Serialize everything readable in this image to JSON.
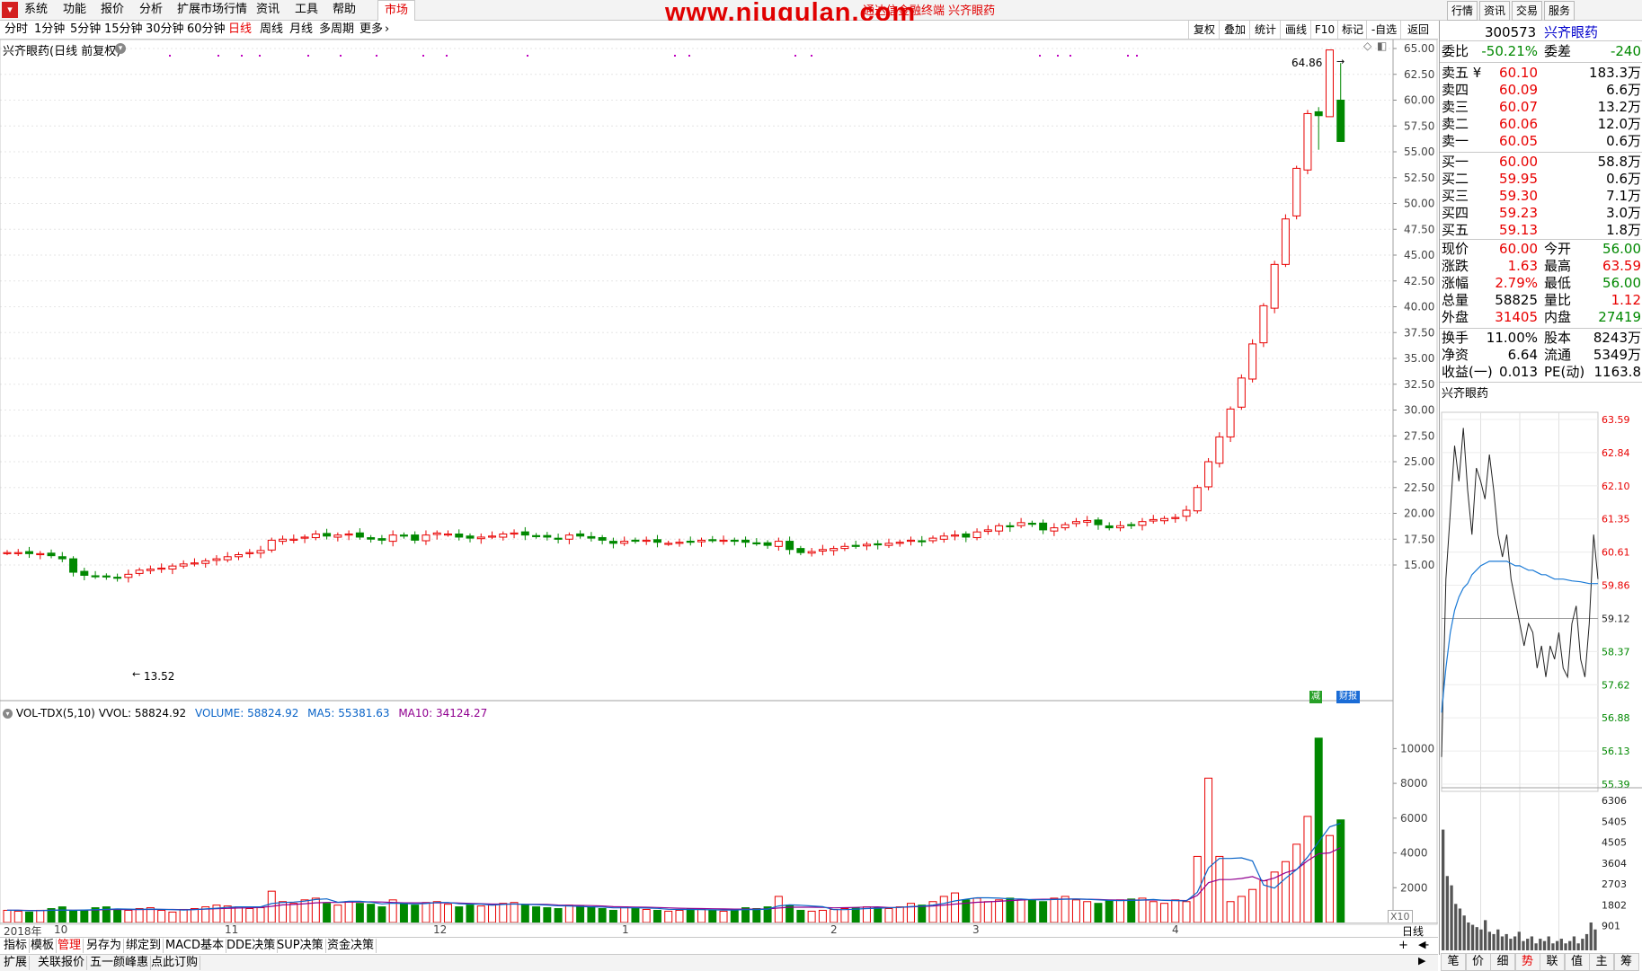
{
  "menu": {
    "items": [
      "系统",
      "功能",
      "报价",
      "分析",
      "扩展市场行情",
      "资讯",
      "工具",
      "帮助"
    ],
    "market_tab": "市场",
    "watermark": "www.niugulan.com",
    "watermark_sub": "通达信金融终端 兴齐眼药",
    "right_buttons": [
      "行情",
      "资讯",
      "交易",
      "服务"
    ]
  },
  "periods": [
    "分时",
    "1分钟",
    "5分钟",
    "15分钟",
    "30分钟",
    "60分钟",
    "日线",
    "周线",
    "月线",
    "多周期",
    "更多"
  ],
  "active_period": "日线",
  "tools": [
    "复权",
    "叠加",
    "统计",
    "画线",
    "F10",
    "标记",
    "-自选",
    "返回"
  ],
  "main_chart": {
    "title": "兴齐眼药(日线 前复权)",
    "low_label": "13.52",
    "high_label": "64.86",
    "price_ticks": [
      "65.00",
      "62.50",
      "60.00",
      "57.50",
      "55.00",
      "52.50",
      "50.00",
      "47.50",
      "45.00",
      "42.50",
      "40.00",
      "37.50",
      "35.00",
      "32.50",
      "30.00",
      "27.50",
      "25.00",
      "22.50",
      "20.00",
      "17.50",
      "15.00"
    ],
    "badge1": "减",
    "badge2": "财报"
  },
  "vol_chart": {
    "title": "VOL-TDX(5,10)",
    "vvol": "VVOL: 58824.92",
    "volume": "VOLUME: 58824.92",
    "ma5": "MA5: 55381.63",
    "ma10": "MA10: 34124.27",
    "ticks": [
      "10000",
      "8000",
      "6000",
      "4000",
      "2000"
    ],
    "scale": "X10"
  },
  "date_axis": {
    "labels": [
      "2018年",
      "10",
      "11",
      "12",
      "1",
      "2",
      "3",
      "4"
    ],
    "right": "日线"
  },
  "chart_data": [
    {
      "type": "candlestick",
      "title": "兴齐眼药(日线 前复权)",
      "ylim": [
        15.0,
        65.0
      ],
      "low_mark": 13.52,
      "high_mark": 64.86,
      "x_labels": [
        "2018年",
        "10",
        "11",
        "12",
        "1",
        "2",
        "3",
        "4"
      ],
      "series": [
        {
          "name": "close (approx.)",
          "values": [
            16.2,
            16.2,
            16.1,
            16.1,
            15.9,
            15.6,
            14.3,
            14.0,
            13.9,
            13.9,
            13.8,
            14.1,
            14.5,
            14.6,
            14.7,
            14.9,
            15.1,
            15.2,
            15.4,
            15.6,
            15.8,
            16.0,
            16.2,
            16.4,
            17.4,
            17.5,
            17.5,
            17.7,
            18.0,
            17.8,
            17.9,
            18.0,
            17.7,
            17.5,
            17.4,
            17.9,
            17.8,
            17.4,
            17.9,
            18.1,
            18.0,
            17.7,
            17.6,
            17.7,
            17.8,
            18.0,
            18.1,
            17.9,
            17.8,
            17.7,
            17.5,
            17.9,
            17.8,
            17.6,
            17.4,
            17.1,
            17.3,
            17.4,
            17.4,
            17.2,
            17.1,
            17.2,
            17.3,
            17.4,
            17.4,
            17.4,
            17.3,
            17.2,
            17.1,
            16.9,
            17.3,
            16.5,
            16.2,
            16.3,
            16.5,
            16.6,
            16.8,
            16.9,
            17.0,
            17.0,
            17.1,
            17.2,
            17.4,
            17.3,
            17.6,
            17.8,
            17.9,
            17.7,
            18.2,
            18.4,
            18.8,
            18.7,
            19.1,
            19.0,
            18.4,
            18.6,
            18.9,
            19.2,
            19.3,
            18.9,
            18.6,
            18.8,
            18.9,
            19.2,
            19.4,
            19.5,
            19.6,
            20.3,
            22.5,
            25.0,
            27.4,
            30.1,
            33.1,
            36.4,
            40.1,
            44.1,
            48.5,
            53.4,
            58.7,
            58.5,
            64.8,
            60.0
          ]
        }
      ]
    },
    {
      "type": "bar",
      "title": "VOL-TDX(5,10)",
      "ylim": [
        0,
        11000
      ],
      "series": [
        {
          "name": "VOLUME",
          "values": [
            700,
            650,
            600,
            700,
            800,
            900,
            650,
            700,
            850,
            900,
            750,
            700,
            800,
            850,
            700,
            600,
            750,
            800,
            900,
            1000,
            950,
            900,
            800,
            850,
            1800,
            1200,
            1100,
            1300,
            1400,
            1100,
            1000,
            1200,
            1100,
            1050,
            900,
            1300,
            1100,
            1000,
            1150,
            1200,
            1050,
            900,
            1000,
            950,
            1000,
            1100,
            1150,
            1000,
            900,
            850,
            800,
            1000,
            950,
            900,
            800,
            700,
            900,
            800,
            750,
            700,
            650,
            700,
            800,
            750,
            700,
            650,
            700,
            850,
            800,
            900,
            1500,
            1000,
            700,
            650,
            700,
            750,
            800,
            850,
            900,
            850,
            800,
            900,
            1100,
            1000,
            1200,
            1500,
            1700,
            1300,
            1400,
            1200,
            1300,
            1400,
            1300,
            1300,
            1200,
            1400,
            1500,
            1300,
            1200,
            1100,
            1250,
            1300,
            1350,
            1400,
            1200,
            1100,
            1300,
            1200,
            3800,
            8300,
            3800,
            1200,
            1500,
            1900,
            2400,
            2900,
            3500,
            4500,
            6100,
            10600,
            5000,
            5900
          ]
        },
        {
          "name": "MA5",
          "values": [
            700,
            700,
            680,
            680,
            700,
            720,
            700,
            720,
            740,
            760,
            780,
            770,
            760,
            770,
            760,
            740,
            720,
            740,
            780,
            820,
            870,
            900,
            900,
            900,
            1090,
            1150,
            1170,
            1230,
            1320,
            1360,
            1160,
            1220,
            1220,
            1170,
            1070,
            1110,
            1090,
            1070,
            1090,
            1150,
            1150,
            1080,
            1060,
            1060,
            1000,
            1040,
            1070,
            1040,
            1030,
            1000,
            960,
            950,
            920,
            900,
            890,
            840,
            840,
            840,
            830,
            810,
            760,
            750,
            750,
            740,
            730,
            720,
            720,
            740,
            740,
            770,
            950,
            1010,
            990,
            950,
            910,
            740,
            740,
            770,
            800,
            820,
            840,
            870,
            920,
            940,
            1000,
            1100,
            1240,
            1340,
            1420,
            1420,
            1400,
            1360,
            1350,
            1310,
            1300,
            1320,
            1340,
            1350,
            1340,
            1300,
            1270,
            1260,
            1270,
            1290,
            1320,
            1270,
            1260,
            1240,
            1740,
            3140,
            3680,
            3680,
            3720,
            3540,
            2160,
            1980,
            2540,
            3040,
            3760,
            4640,
            5500,
            5700
          ]
        },
        {
          "name": "MA10",
          "values": [
            700,
            700,
            690,
            690,
            700,
            710,
            700,
            710,
            720,
            740,
            750,
            745,
            740,
            755,
            750,
            750,
            740,
            750,
            770,
            790,
            810,
            830,
            840,
            860,
            930,
            1010,
            1040,
            1080,
            1130,
            1150,
            1150,
            1170,
            1180,
            1190,
            1180,
            1150,
            1130,
            1130,
            1130,
            1130,
            1130,
            1120,
            1100,
            1080,
            1060,
            1060,
            1060,
            1050,
            1050,
            1040,
            1000,
            990,
            980,
            970,
            950,
            910,
            900,
            890,
            880,
            860,
            840,
            820,
            810,
            800,
            790,
            780,
            770,
            770,
            770,
            780,
            830,
            880,
            880,
            880,
            870,
            840,
            850,
            870,
            890,
            900,
            860,
            870,
            900,
            920,
            950,
            1000,
            1060,
            1110,
            1160,
            1190,
            1220,
            1260,
            1290,
            1320,
            1340,
            1340,
            1350,
            1350,
            1340,
            1320,
            1300,
            1290,
            1290,
            1290,
            1290,
            1280,
            1270,
            1260,
            1560,
            2290,
            2470,
            2470,
            2530,
            2640,
            2390,
            2560,
            2860,
            3050,
            3550,
            3950,
            4000,
            4300
          ]
        }
      ]
    },
    {
      "type": "line",
      "title": "兴齐眼药",
      "ylim": [
        55.39,
        63.59
      ],
      "series": [
        {
          "name": "price",
          "values": [
            56.0,
            60.0,
            61.5,
            63.0,
            62.2,
            63.4,
            62.0,
            61.0,
            62.5,
            62.2,
            61.8,
            62.8,
            62.0,
            61.0,
            60.5,
            61.0,
            60.0,
            59.5,
            59.0,
            58.5,
            59.0,
            58.8,
            58.0,
            58.5,
            57.8,
            58.5,
            58.2,
            58.8,
            58.0,
            57.8,
            59.0,
            59.4,
            58.2,
            57.8,
            59.0,
            61.0,
            60.0
          ]
        },
        {
          "name": "avg",
          "values": [
            57.0,
            58.0,
            58.8,
            59.3,
            59.6,
            59.8,
            59.9,
            60.1,
            60.2,
            60.3,
            60.35,
            60.4,
            60.4,
            60.4,
            60.4,
            60.4,
            60.35,
            60.3,
            60.3,
            60.25,
            60.2,
            60.2,
            60.15,
            60.1,
            60.1,
            60.05,
            60.0,
            60.0,
            60.0,
            59.98,
            59.96,
            59.95,
            59.94,
            59.92,
            59.9,
            59.9,
            59.9
          ]
        }
      ]
    },
    {
      "type": "bar",
      "title": "",
      "ylim": [
        0,
        6306
      ],
      "series": [
        {
          "name": "intraday volume",
          "values": [
            5200,
            3200,
            2800,
            2000,
            1800,
            1500,
            1200,
            1100,
            1000,
            900,
            1300,
            800,
            700,
            900,
            600,
            700,
            500,
            600,
            800,
            400,
            500,
            600,
            300,
            500,
            400,
            600,
            300,
            400,
            500,
            300,
            400,
            600,
            300,
            500,
            700,
            1200,
            900
          ]
        }
      ]
    }
  ],
  "info": {
    "code": "300573",
    "name": "兴齐眼药",
    "weibi_label": "委比",
    "weibi": "-50.21%",
    "weicha_label": "委差",
    "weicha": "-240",
    "asks": [
      {
        "label": "卖五",
        "marker": "¥",
        "price": "60.10",
        "vol": "183.3万"
      },
      {
        "label": "卖四",
        "marker": "",
        "price": "60.09",
        "vol": "6.6万"
      },
      {
        "label": "卖三",
        "marker": "",
        "price": "60.07",
        "vol": "13.2万"
      },
      {
        "label": "卖二",
        "marker": "",
        "price": "60.06",
        "vol": "12.0万"
      },
      {
        "label": "卖一",
        "marker": "",
        "price": "60.05",
        "vol": "0.6万"
      }
    ],
    "bids": [
      {
        "label": "买一",
        "price": "60.00",
        "vol": "58.8万"
      },
      {
        "label": "买二",
        "price": "59.95",
        "vol": "0.6万"
      },
      {
        "label": "买三",
        "price": "59.30",
        "vol": "7.1万"
      },
      {
        "label": "买四",
        "price": "59.23",
        "vol": "3.0万"
      },
      {
        "label": "买五",
        "price": "59.13",
        "vol": "1.8万"
      }
    ],
    "stats1": [
      {
        "k": "现价",
        "v": "60.00",
        "vc": "red",
        "k2": "今开",
        "v2": "56.00",
        "v2c": "green"
      },
      {
        "k": "涨跌",
        "v": "1.63",
        "vc": "red",
        "k2": "最高",
        "v2": "63.59",
        "v2c": "red"
      },
      {
        "k": "涨幅",
        "v": "2.79%",
        "vc": "red",
        "k2": "最低",
        "v2": "56.00",
        "v2c": "green"
      },
      {
        "k": "总量",
        "v": "58825",
        "vc": "black",
        "k2": "量比",
        "v2": "1.12",
        "v2c": "red"
      },
      {
        "k": "外盘",
        "v": "31405",
        "vc": "red",
        "k2": "内盘",
        "v2": "27419",
        "v2c": "green"
      }
    ],
    "stats2": [
      {
        "k": "换手",
        "v": "11.00%",
        "k2": "股本",
        "v2": "8243万"
      },
      {
        "k": "净资",
        "v": "6.64",
        "k2": "流通",
        "v2": "5349万"
      },
      {
        "k": "收益(一)",
        "v": "0.013",
        "k2": "PE(动)",
        "v2": "1163.8"
      }
    ],
    "mini_title": "兴齐眼药",
    "mini_ticks": [
      "63.59",
      "62.84",
      "62.10",
      "61.35",
      "60.61",
      "59.86",
      "59.12",
      "58.37",
      "57.62",
      "56.88",
      "56.13",
      "55.39"
    ],
    "mini_vol_ticks": [
      "6306",
      "5405",
      "4505",
      "3604",
      "2703",
      "1802",
      "901"
    ],
    "bottom_tabs": [
      "笔",
      "价",
      "细",
      "势",
      "联",
      "值",
      "主",
      "筹"
    ],
    "active_bottom_tab": "势"
  },
  "bottom": {
    "tabs1": [
      "指标",
      "模板",
      "管理",
      "另存为",
      "绑定到",
      "MACD基本",
      "DDE决策",
      "SUP决策",
      "资金决策"
    ],
    "active_tab1": "管理",
    "tabs2": [
      "扩展",
      "关联报价",
      "五一颜峰惠",
      "点此订购"
    ],
    "plus": "+",
    "minus": "−",
    "left_arrow": "◀",
    "right_arrow": "▶"
  },
  "colors": {
    "up": "#e80000",
    "down": "#008800",
    "ma5": "#0a64c8",
    "ma10": "#900090",
    "purple_dot": "#c000c0"
  }
}
